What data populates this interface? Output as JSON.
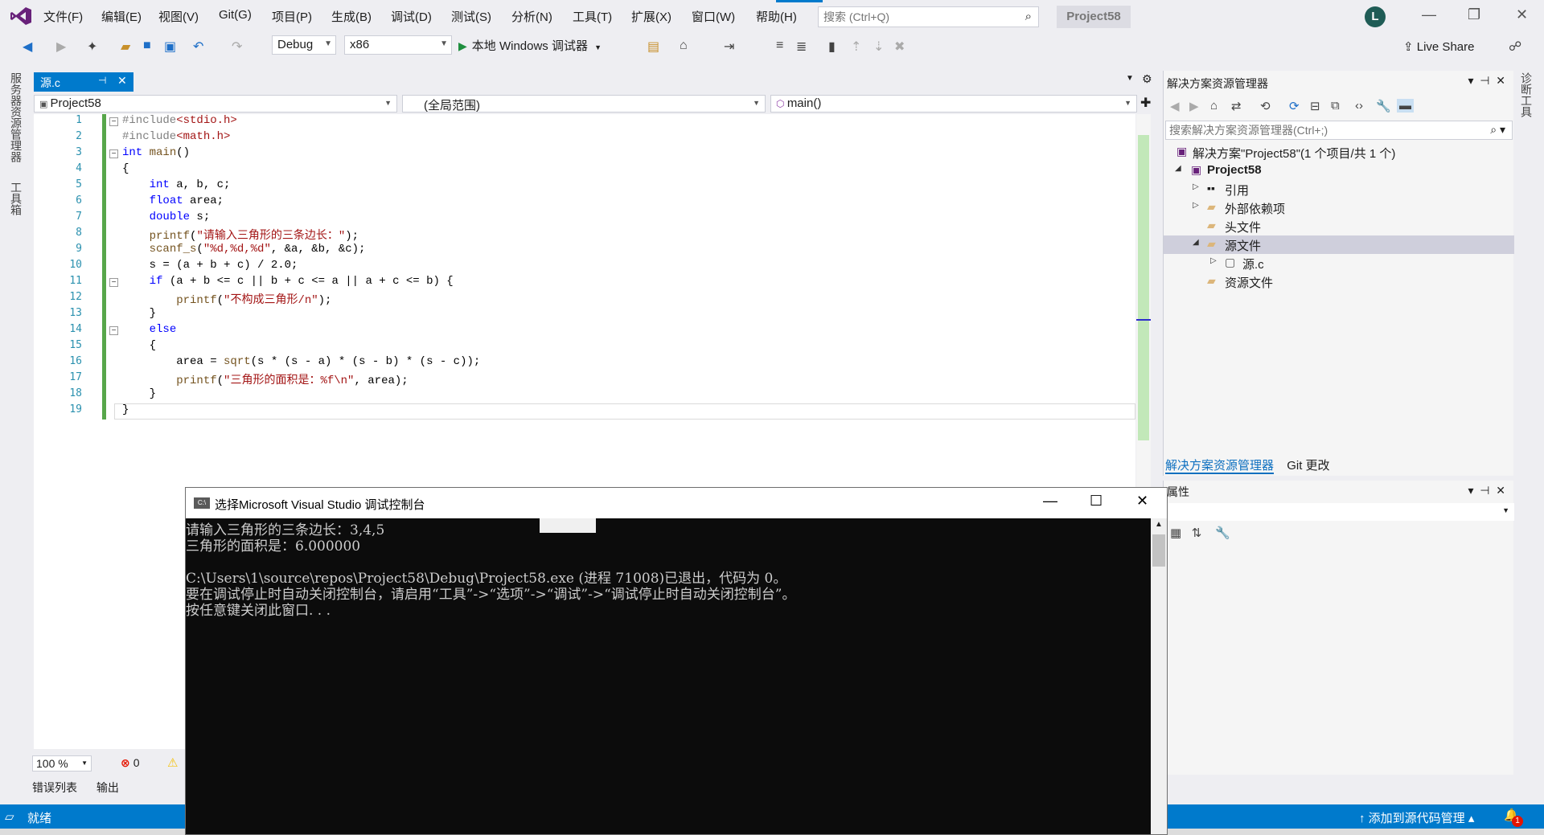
{
  "menu": [
    "文件(F)",
    "编辑(E)",
    "视图(V)",
    "Git(G)",
    "项目(P)",
    "生成(B)",
    "调试(D)",
    "测试(S)",
    "分析(N)",
    "工具(T)",
    "扩展(X)",
    "窗口(W)",
    "帮助(H)"
  ],
  "search": {
    "placeholder": "搜索 (Ctrl+Q)"
  },
  "project_title": "Project58",
  "avatar_letter": "L",
  "toolbar": {
    "config": "Debug",
    "platform": "x86",
    "run_label": "本地 Windows 调试器",
    "live_share": "Live Share"
  },
  "left_strip": {
    "server_explorer": "服务器资源管理器",
    "toolbox": "工具箱"
  },
  "right_strip": {
    "diagnostic_tools": "诊断工具"
  },
  "editor": {
    "tab_name": "源.c",
    "nav_project": "Project58",
    "nav_scope": "(全局范围)",
    "nav_member": "main()",
    "line_numbers": [
      "1",
      "2",
      "3",
      "4",
      "5",
      "6",
      "7",
      "8",
      "9",
      "10",
      "11",
      "12",
      "13",
      "14",
      "15",
      "16",
      "17",
      "18",
      "19"
    ],
    "zoom": "100 %",
    "error_count": "0"
  },
  "bottom_tabs": [
    "错误列表",
    "输出"
  ],
  "status": {
    "ready": "就绪",
    "source_control": "添加到源代码管理",
    "notifications": "1"
  },
  "solution_explorer": {
    "title": "解决方案资源管理器",
    "search_placeholder": "搜索解决方案资源管理器(Ctrl+;)",
    "tree": [
      {
        "label": "解决方案\"Project58\"(1 个项目/共 1 个)",
        "icon": "solution-icon"
      },
      {
        "label": "Project58",
        "icon": "project-icon"
      },
      {
        "label": "引用",
        "icon": "references-icon"
      },
      {
        "label": "外部依赖项",
        "icon": "external-deps-icon"
      },
      {
        "label": "头文件",
        "icon": "folder-icon"
      },
      {
        "label": "源文件",
        "icon": "folder-icon"
      },
      {
        "label": "源.c",
        "icon": "c-file-icon"
      },
      {
        "label": "资源文件",
        "icon": "folder-icon"
      }
    ],
    "tabs": [
      "解决方案资源管理器",
      "Git 更改"
    ]
  },
  "properties": {
    "title": "属性"
  },
  "console": {
    "title": "选择Microsoft Visual Studio 调试控制台",
    "lines": [
      "请输入三角形的三条边长：3,4,5",
      "三角形的面积是：6.000000",
      "",
      "C:\\Users\\1\\source\\repos\\Project58\\Debug\\Project58.exe (进程 71008)已退出，代码为 0。",
      "要在调试停止时自动关闭控制台，请启用“工具”->“选项”->“调试”->“调试停止时自动关闭控制台”。",
      "按任意键关闭此窗口. . ."
    ]
  },
  "colors": {
    "accent": "#007acc",
    "keyword": "#0000ff",
    "string": "#a31515",
    "preprocessor": "#808080",
    "change_bar": "#57a64a"
  }
}
